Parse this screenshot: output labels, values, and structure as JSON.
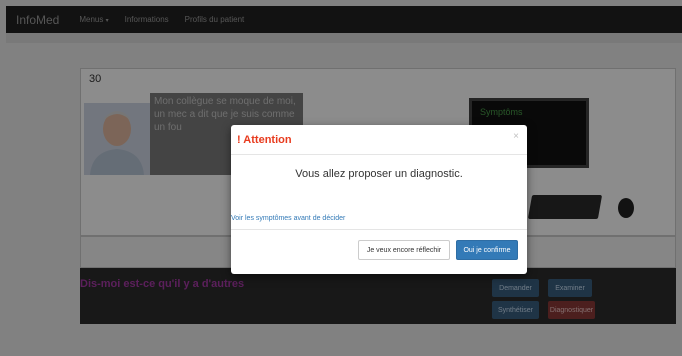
{
  "navbar": {
    "brand": "InfoMed",
    "menu_label": "Menus",
    "informations_label": "Informations",
    "profils_label": "Profils du patient"
  },
  "panel": {
    "number": "30",
    "speech_text": "Mon collègue se moque de moi, un mec a dit que je suis comme un fou",
    "monitor_text": "Symptôms"
  },
  "bottom": {
    "prompt_text": "Dis-moi est-ce qu'il y a d'autres",
    "buttons": {
      "demander": "Demander",
      "examiner": "Examiner",
      "synthetiser": "Synthétiser",
      "diagnostiquer": "Diagnostiquer"
    }
  },
  "modal": {
    "title": "! Attention",
    "close_symbol": "×",
    "message": "Vous allez proposer un diagnostic.",
    "link_text": "Voir les symptômes avant de décider",
    "cancel_label": "Je veux encore réflechir",
    "confirm_label": "Oui je confirme"
  },
  "colors": {
    "title_red": "#e83b1e",
    "primary_blue": "#337ab7",
    "navbar_bg": "#222222"
  }
}
